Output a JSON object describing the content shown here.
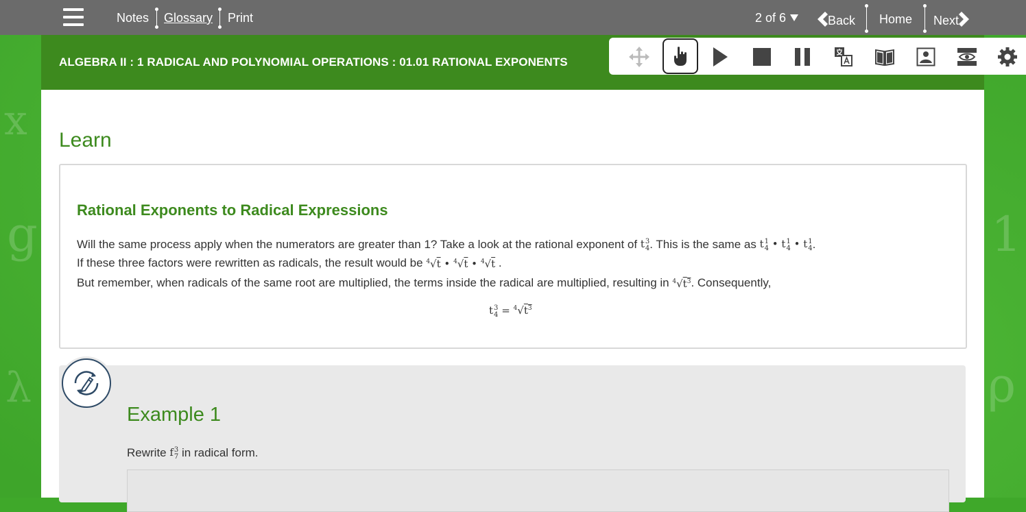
{
  "topbar": {
    "notes": "Notes",
    "glossary": "Glossary",
    "print": "Print",
    "page_indicator": "2 of 6",
    "back": "Back",
    "home": "Home",
    "next": "Next"
  },
  "header": {
    "course_title": "ALGEBRA II : 1 RADICAL AND POLYNOMIAL OPERATIONS : 01.01 RATIONAL EXPONENTS"
  },
  "toolbar": {
    "tools": [
      "move-icon",
      "hand-pointer-icon",
      "play-icon",
      "stop-icon",
      "pause-icon",
      "translate-icon",
      "book-icon",
      "image-icon",
      "eye-icon",
      "gear-icon"
    ]
  },
  "content": {
    "section_title": "Learn",
    "card": {
      "title": "Rational Exponents to Radical Expressions",
      "line1_a": "Will the same process apply when the numerators are greater than 1? Take a look at the rational exponent of",
      "line1_b": ". This is the same as",
      "line2_a": "If these three factors were rewritten as radicals, the result would be",
      "line3_a": "But remember, when radicals of the same root are multiplied, the terms inside the radical are multiplied, resulting in",
      "line3_b": ". Consequently,",
      "math": {
        "base": "t",
        "num3": "3",
        "num1": "1",
        "den": "4",
        "index": "4",
        "power": "3",
        "dot": "•",
        "radical": "√",
        "equals": "=",
        "period": "."
      }
    },
    "example": {
      "title": "Example 1",
      "text_a": "Rewrite",
      "base": "f",
      "num": "3",
      "den": "7",
      "text_b": "in radical form."
    }
  },
  "colors": {
    "topbar": "#6b6b6b",
    "header_green": "#3d8a1e",
    "accent_green": "#3d8a1e",
    "background_green": "#3ea52a"
  }
}
